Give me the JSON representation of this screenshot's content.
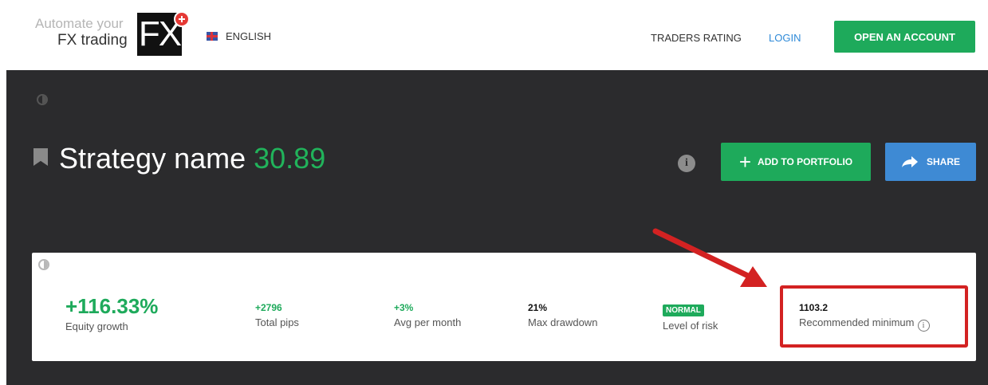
{
  "header": {
    "logo": {
      "line1": "Automate your",
      "line2": "FX trading",
      "mark": "FX"
    },
    "language": "ENGLISH",
    "nav": {
      "traders_rating": "TRADERS RATING",
      "login": "LOGIN"
    },
    "open_account": "OPEN AN ACCOUNT"
  },
  "strategy": {
    "name": "Strategy name",
    "score": "30.89",
    "actions": {
      "add_to_portfolio": "ADD TO PORTFOLIO",
      "share": "SHARE"
    }
  },
  "stats": {
    "equity_growth": {
      "value": "+116.33%",
      "label": "Equity growth"
    },
    "total_pips": {
      "value": "+2796",
      "label": "Total pips"
    },
    "avg_per_month": {
      "value": "+3%",
      "label": "Avg per month"
    },
    "max_drawdown": {
      "value": "21%",
      "label": "Max drawdown"
    },
    "level_of_risk": {
      "value": "NORMAL",
      "label": "Level of risk"
    },
    "recommended_minimum": {
      "value": "1103.2",
      "label": "Recommended minimum"
    }
  },
  "colors": {
    "accent_green": "#1eaa5b",
    "share_blue": "#3e8ad4",
    "dark_band": "#2b2b2d",
    "highlight_red": "#d32222"
  }
}
